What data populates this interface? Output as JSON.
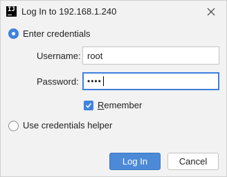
{
  "window": {
    "title": "Log In to 192.168.1.240",
    "app_icon_glyph": "IJ",
    "close_icon": "close-icon"
  },
  "auth_options": {
    "credentials_label": "Enter credentials",
    "credentials_selected": true,
    "helper_label": "Use credentials helper",
    "helper_selected": false
  },
  "form": {
    "username_label": "Username:",
    "username_value": "root",
    "password_label": "Password:",
    "password_value": "••••",
    "remember_label": "Remember",
    "remember_checked": true
  },
  "buttons": {
    "login_label": "Log In",
    "cancel_label": "Cancel"
  },
  "colors": {
    "accent": "#3f84e0",
    "primary_button": "#4c8ad8",
    "background": "#f2f2f2"
  }
}
